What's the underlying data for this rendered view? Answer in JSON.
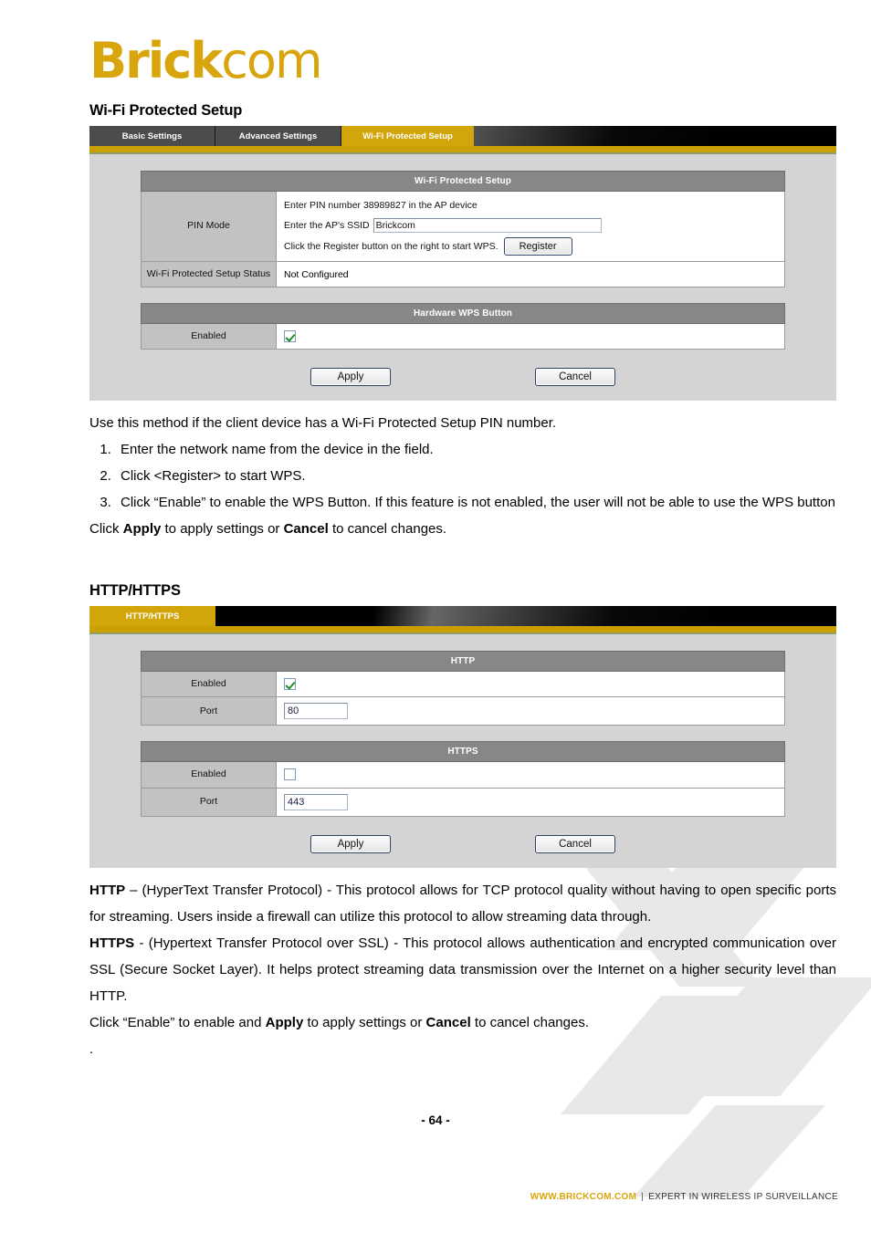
{
  "brand": {
    "logo_bold": "Brick",
    "logo_light": "com",
    "logo_color": "#d9a50c"
  },
  "wps_section": {
    "heading": "Wi-Fi Protected Setup",
    "tabs": [
      {
        "label": "Basic Settings",
        "active": false
      },
      {
        "label": "Advanced Settings",
        "active": false
      },
      {
        "label": "Wi-Fi Protected Setup",
        "active": true
      }
    ],
    "panel": {
      "header": "Wi-Fi Protected Setup",
      "pin_mode_label": "PIN Mode",
      "pin_line_1": "Enter PIN number 38989827 in the AP device",
      "pin_number": "38989827",
      "ssid_prompt": "Enter the AP's SSID",
      "ssid_value": "Brickcom",
      "register_hint": "Click the Register button on the right to start WPS.",
      "register_button": "Register",
      "status_label": "Wi-Fi Protected Setup Status",
      "status_value": "Not Configured"
    },
    "hardware_panel": {
      "header": "Hardware WPS Button",
      "enabled_label": "Enabled",
      "enabled_checked": true
    },
    "apply_label": "Apply",
    "cancel_label": "Cancel"
  },
  "wps_body": {
    "intro": "Use this method if the client device has a Wi-Fi Protected Setup PIN number.",
    "steps": [
      "Enter the network name from the device in the field.",
      "Click <Register> to start WPS.",
      "Click “Enable” to enable the WPS Button.    If this feature is not enabled, the user will not be able to use the WPS button"
    ],
    "closing_pre": "Click ",
    "closing_apply": "Apply",
    "closing_mid": " to apply settings or ",
    "closing_cancel": "Cancel",
    "closing_post": " to cancel changes."
  },
  "http_section": {
    "heading": "HTTP/HTTPS",
    "tabs": [
      {
        "label": "HTTP/HTTPS",
        "active": true
      }
    ],
    "http_panel": {
      "header": "HTTP",
      "enabled_label": "Enabled",
      "enabled_checked": true,
      "port_label": "Port",
      "port_value": "80"
    },
    "https_panel": {
      "header": "HTTPS",
      "enabled_label": "Enabled",
      "enabled_checked": false,
      "port_label": "Port",
      "port_value": "443"
    },
    "apply_label": "Apply",
    "cancel_label": "Cancel"
  },
  "http_body": {
    "http_term": "HTTP",
    "http_text": " – (HyperText Transfer Protocol) - This protocol allows for TCP protocol quality without having to open specific ports for streaming. Users inside a firewall can utilize this protocol to allow streaming data through.",
    "https_term": "HTTPS",
    "https_text": " - (Hypertext Transfer Protocol over SSL) - This protocol allows authentication and encrypted communication over SSL (Secure Socket Layer). It helps protect streaming data transmission over the Internet on a higher security level than HTTP.",
    "closing_pre": "Click “Enable” to enable and ",
    "closing_apply": "Apply",
    "closing_mid": " to apply settings or ",
    "closing_cancel": "Cancel",
    "closing_post": " to cancel changes.",
    "trailing_dot": "."
  },
  "footer": {
    "page_number": "- 64 -",
    "url": "WWW.BRICKCOM.COM",
    "separator": "|",
    "tagline": "EXPERT IN WIRELESS IP SURVEILLANCE"
  }
}
